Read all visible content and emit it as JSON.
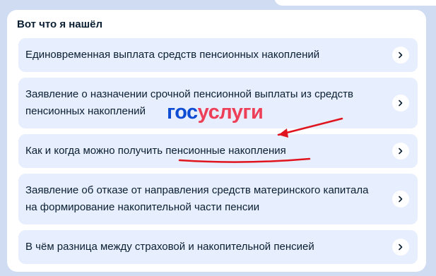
{
  "panel": {
    "title": "Вот что я нашёл"
  },
  "items": [
    {
      "label": "Единовременная выплата средств пенсионных накоплений"
    },
    {
      "label": "Заявление о назначении срочной пенсионной выплаты из средств пенсионных накоплений"
    },
    {
      "label_prefix": "Как и когда можно получить ",
      "label_highlight": "пенсионные накопления"
    },
    {
      "label": "Заявление об отказе от направления средств материнского капитала на формирование накопительной части пенсии"
    },
    {
      "label": "В чём разница между страховой и накопительной пенсией"
    }
  ],
  "logo": {
    "part1": "гос",
    "part2": "услуги"
  },
  "colors": {
    "background": "#cfdcf2",
    "card": "#e7eefd",
    "text": "#0b1f33",
    "logo_blue": "#0d4cd3",
    "logo_red": "#ee3f58",
    "annotation_red": "#e0141e"
  },
  "icons": {
    "chevron": "chevron-right-icon",
    "annotation": "arrow-annotation"
  }
}
